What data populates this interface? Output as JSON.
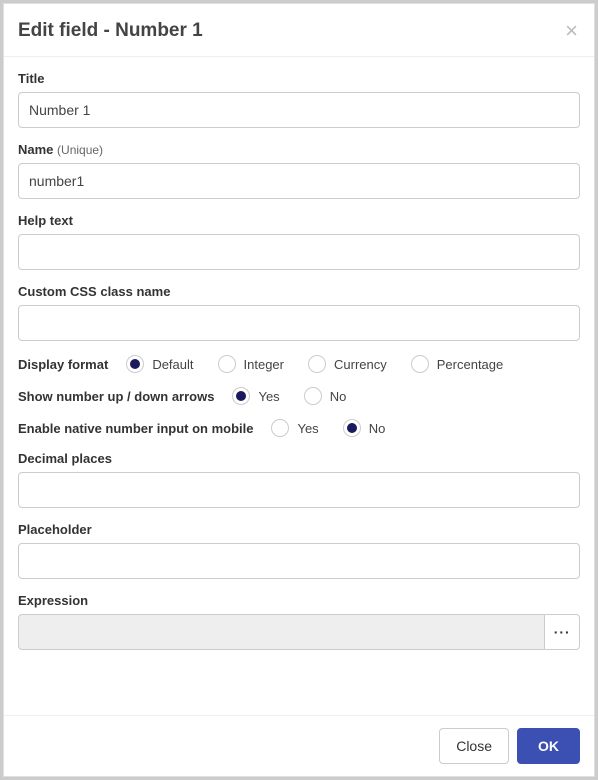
{
  "header": {
    "title": "Edit field - Number 1",
    "close_glyph": "×"
  },
  "fields": {
    "title_label": "Title",
    "title_value": "Number 1",
    "name_label": "Name ",
    "name_sublabel": "(Unique)",
    "name_value": "number1",
    "help_label": "Help text",
    "help_value": "",
    "css_label": "Custom CSS class name",
    "css_value": "",
    "display_format_label": "Display format",
    "display_format": {
      "options": [
        "Default",
        "Integer",
        "Currency",
        "Percentage"
      ],
      "selected": "Default"
    },
    "arrows_label": "Show number up / down arrows",
    "arrows": {
      "options": [
        "Yes",
        "No"
      ],
      "selected": "Yes"
    },
    "native_label": "Enable native number input on mobile",
    "native": {
      "options": [
        "Yes",
        "No"
      ],
      "selected": "No"
    },
    "decimal_label": "Decimal places",
    "decimal_value": "",
    "placeholder_label": "Placeholder",
    "placeholder_value": "",
    "expression_label": "Expression",
    "expression_value": "",
    "expression_btn": "···"
  },
  "footer": {
    "close": "Close",
    "ok": "OK"
  }
}
